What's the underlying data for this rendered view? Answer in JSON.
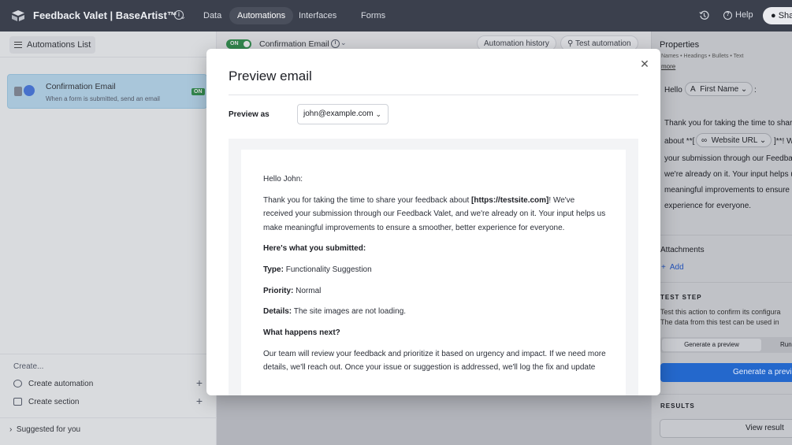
{
  "topbar": {
    "app_title": "Feedback Valet | BaseArtist™",
    "nav": [
      "Data",
      "Automations",
      "Interfaces",
      "Forms"
    ],
    "help": "Help",
    "share": "Share"
  },
  "sidebar": {
    "header": "Automations List",
    "automation": {
      "title": "Confirmation Email",
      "subtitle": "When a form is submitted, send an email",
      "status": "ON"
    },
    "create_label": "Create...",
    "create_automation": "Create automation",
    "create_section": "Create section",
    "suggested": "Suggested for you"
  },
  "editor": {
    "toggle": "ON",
    "title": "Confirmation Email",
    "history_button": "Automation history",
    "test_button": "Test automation"
  },
  "properties": {
    "title": "Properties",
    "toolbar_fragment": "Names • Headings • Bullets • Text",
    "more": "more",
    "hello": "Hello",
    "first_name_chip": "First Name",
    "colon": ":",
    "body_lines": [
      "Thank you for taking the time to share",
      "your submission through our Feedba",
      "we're already on it. Your input helps u",
      "meaningful improvements to ensure a",
      "experience for everyone."
    ],
    "about_prefix": "about **[",
    "website_chip": "Website URL",
    "about_suffix": "]**! W",
    "attachments": "Attachments",
    "add": "Add",
    "test_step": "TEST STEP",
    "test_desc_1": "Test this action to confirm its configura",
    "test_desc_2": "The data from this test can be used in",
    "tab_generate": "Generate a preview",
    "tab_run": "Run",
    "generate_button": "Generate a preview",
    "results": "RESULTS",
    "view_result": "View result"
  },
  "modal": {
    "title": "Preview email",
    "preview_as_label": "Preview as",
    "preview_as_value": "john@example.com",
    "email": {
      "greeting": "Hello John:",
      "p1_a": "Thank you for taking the time to share your feedback about ",
      "p1_link": "[https://testsite.com]",
      "p1_b": "! We've",
      "p1_line2": "received your submission through our Feedback Valet, and we're already on it. Your input helps us",
      "p1_line3": "make meaningful improvements to ensure a smoother, better experience for everyone.",
      "submitted_heading": "Here's what you submitted:",
      "type_label": "Type:",
      "type_value": " Functionality Suggestion",
      "priority_label": "Priority:",
      "priority_value": " Normal",
      "details_label": "Details:",
      "details_value": " The site images are not loading.",
      "next_heading": "What happens next?",
      "p2_line1": "Our team will review your feedback and prioritize it based on urgency and impact. If we need more",
      "p2_line2": "details, we'll reach out. Once your issue or suggestion is addressed, we'll log the fix and update"
    }
  }
}
